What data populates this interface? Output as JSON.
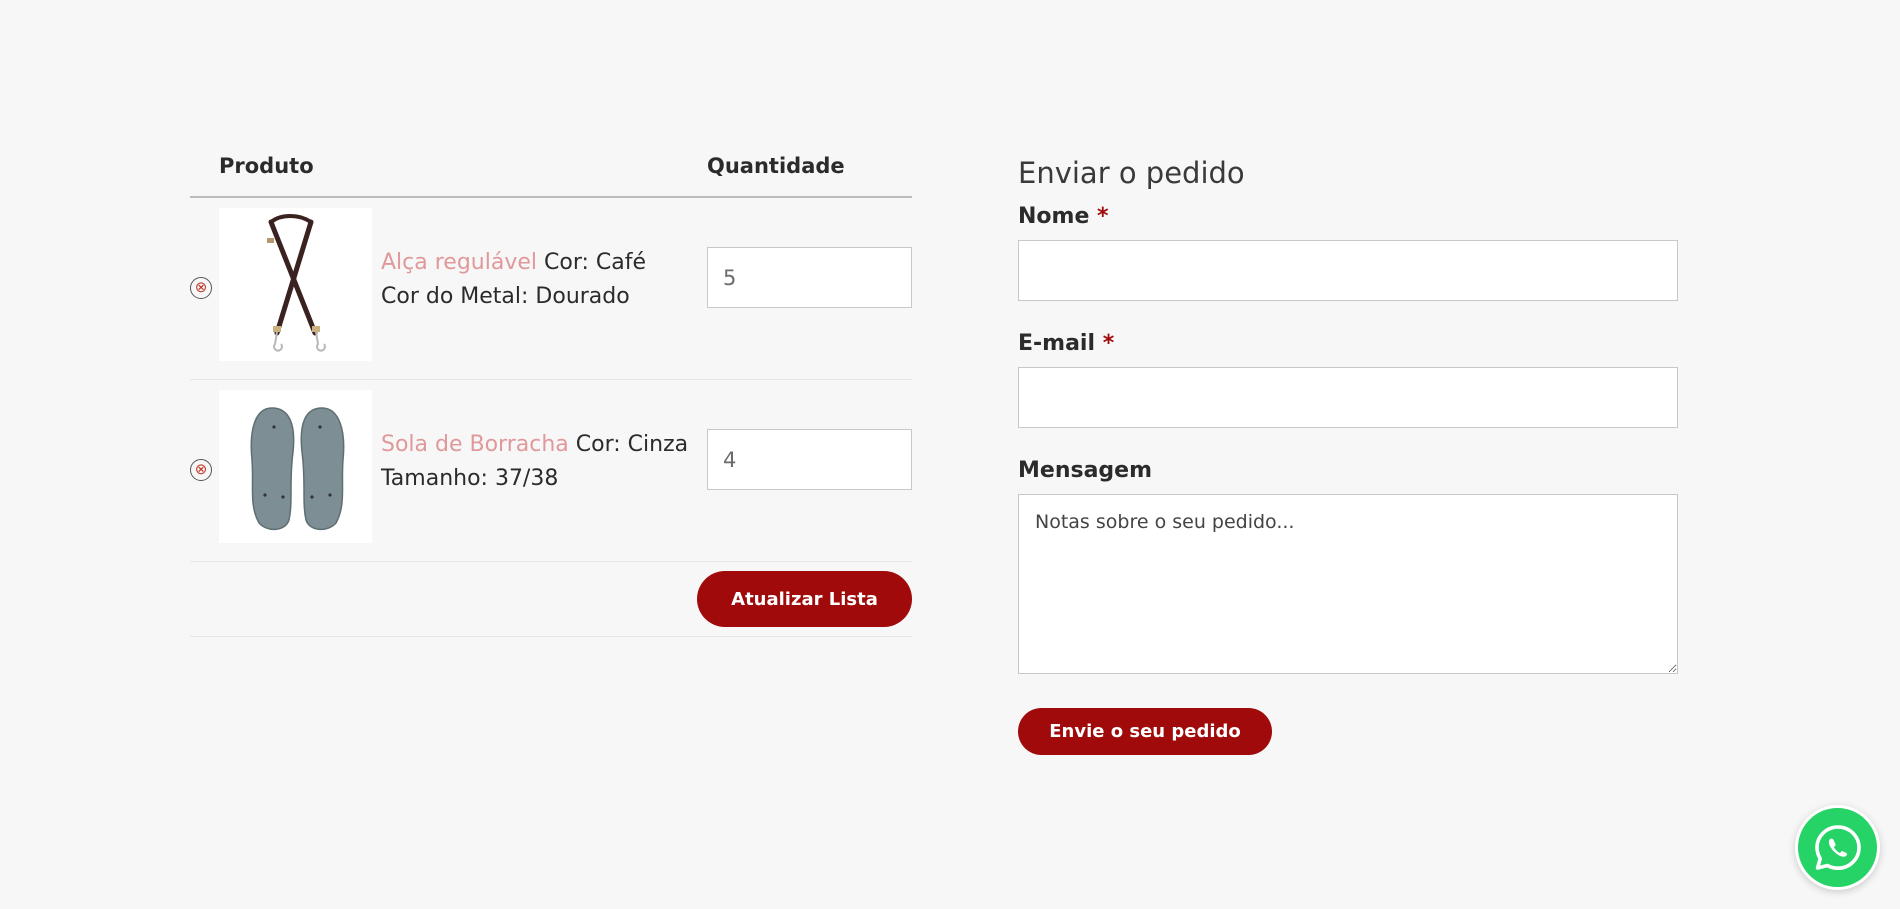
{
  "cart": {
    "headers": {
      "product": "Produto",
      "quantity": "Quantidade"
    },
    "items": [
      {
        "name": "Alça regulável",
        "attr1": "Cor: Café",
        "attr2": "Cor do Metal: Dourado",
        "quantity": "5",
        "remove_symbol": "⊗",
        "thumbnail_icon": "strap-icon"
      },
      {
        "name": "Sola de Borracha",
        "attr1": "Cor: Cinza",
        "attr2": "Tamanho: 37/38",
        "quantity": "4",
        "remove_symbol": "⊗",
        "thumbnail_icon": "sole-icon"
      }
    ],
    "update_label": "Atualizar Lista"
  },
  "form": {
    "title": "Enviar o pedido",
    "name_label": "Nome",
    "email_label": "E-mail",
    "required_mark": "*",
    "message_label": "Mensagem",
    "message_placeholder": "Notas sobre o seu pedido...",
    "submit_label": "Envie o seu pedido"
  },
  "colors": {
    "accent": "#a00a0a",
    "product_link": "#e0999a",
    "whatsapp": "#25d366",
    "background": "#f7f7f7"
  },
  "whatsapp": {
    "icon": "whatsapp-icon"
  }
}
